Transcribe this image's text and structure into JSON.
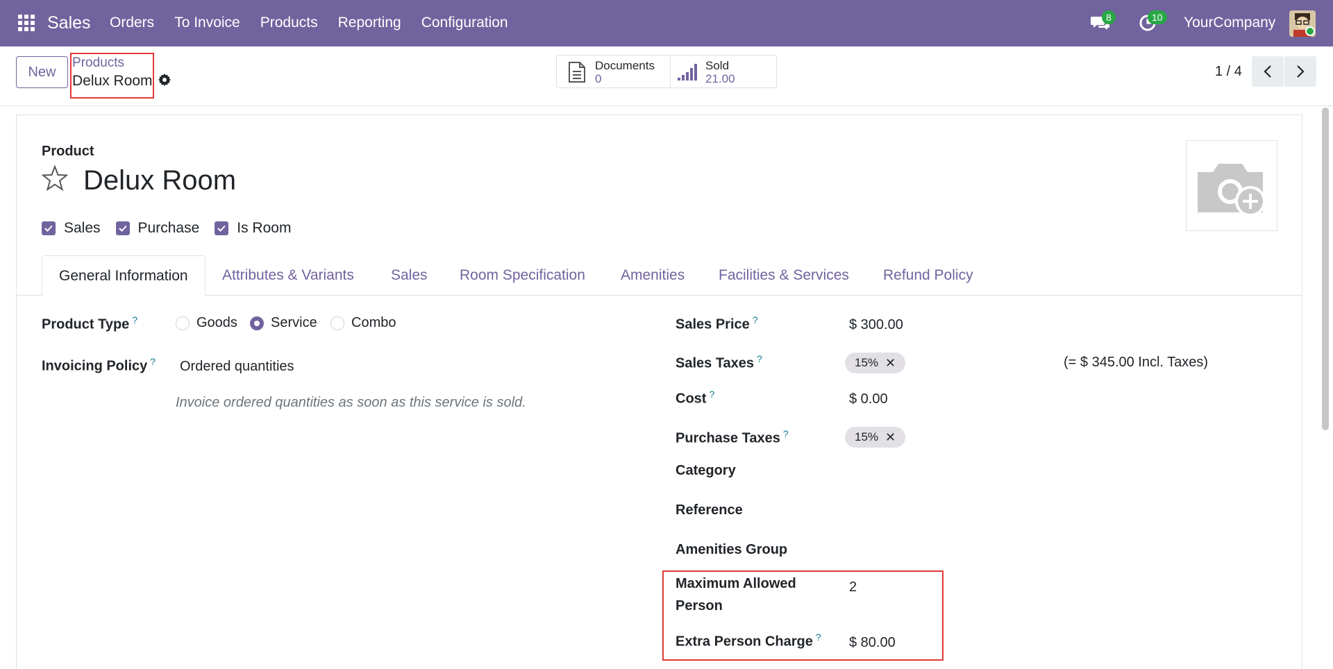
{
  "navbar": {
    "brand": "Sales",
    "menu": [
      "Orders",
      "To Invoice",
      "Products",
      "Reporting",
      "Configuration"
    ],
    "chat_count": "8",
    "activity_count": "10",
    "company": "YourCompany"
  },
  "control": {
    "new_label": "New",
    "breadcrumb_parent": "Products",
    "breadcrumb_current": "Delux Room",
    "documents_label": "Documents",
    "documents_value": "0",
    "sold_label": "Sold",
    "sold_value": "21.00",
    "pager": "1 / 4"
  },
  "product": {
    "section_label": "Product",
    "name": "Delux Room",
    "checkboxes": [
      "Sales",
      "Purchase",
      "Is Room"
    ]
  },
  "tabs": [
    "General Information",
    "Attributes & Variants",
    "Sales",
    "Room Specification",
    "Amenities",
    "Facilities & Services",
    "Refund Policy"
  ],
  "left_fields": {
    "product_type_label": "Product Type",
    "product_type_options": [
      "Goods",
      "Service",
      "Combo"
    ],
    "product_type_selected": "Service",
    "invoicing_policy_label": "Invoicing Policy",
    "invoicing_policy_value": "Ordered quantities",
    "invoicing_note": "Invoice ordered quantities as soon as this service is sold."
  },
  "right_fields": {
    "sales_price_label": "Sales Price",
    "sales_price_value": "$ 300.00",
    "sales_taxes_label": "Sales Taxes",
    "sales_taxes_tag": "15%",
    "incl_taxes": "(= $ 345.00 Incl. Taxes)",
    "cost_label": "Cost",
    "cost_value": "$ 0.00",
    "purchase_taxes_label": "Purchase Taxes",
    "purchase_taxes_tag": "15%",
    "category_label": "Category",
    "reference_label": "Reference",
    "amenities_group_label": "Amenities Group",
    "max_person_label_1": "Maximum Allowed",
    "max_person_label_2": "Person",
    "max_person_value": "2",
    "extra_charge_label": "Extra Person Charge",
    "extra_charge_value": "$ 80.00"
  },
  "help_mark": "?",
  "remove_mark": "✕",
  "colors": {
    "primary": "#71639e",
    "highlight": "#e53935",
    "badge": "#28a745"
  }
}
